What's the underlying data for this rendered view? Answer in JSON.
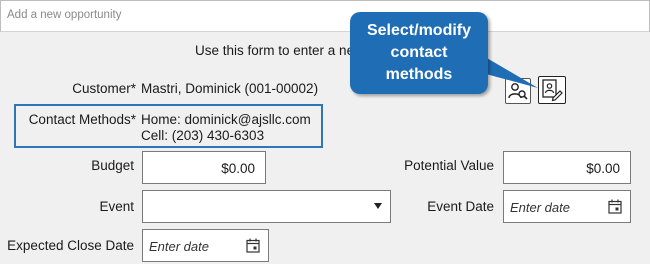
{
  "window": {
    "title": "Add a new opportunity"
  },
  "intro_text": "Use this form to enter a ne",
  "customer": {
    "label": "Customer*",
    "value": "Mastri, Dominick (001-00002)"
  },
  "contact_methods": {
    "label": "Contact Methods*",
    "home": "Home: dominick@ajsllc.com",
    "cell": "Cell: (203) 430-6303"
  },
  "budget": {
    "label": "Budget",
    "value": "$0.00"
  },
  "potential_value": {
    "label": "Potential Value",
    "value": "$0.00"
  },
  "event": {
    "label": "Event",
    "value": ""
  },
  "event_date": {
    "label": "Event Date",
    "placeholder": "Enter date"
  },
  "expected_close_date": {
    "label": "Expected Close Date",
    "placeholder": "Enter date"
  },
  "callout": {
    "line1": "Select/modify",
    "line2": "contact",
    "line3": "methods"
  },
  "colors": {
    "accent": "#2e75b6",
    "callout_bg": "#1f6db5",
    "background": "#f0f0f0"
  },
  "icons": {
    "customer_search": "person-search-icon",
    "contact_edit": "contact-card-edit-icon",
    "calendar": "calendar-icon"
  }
}
